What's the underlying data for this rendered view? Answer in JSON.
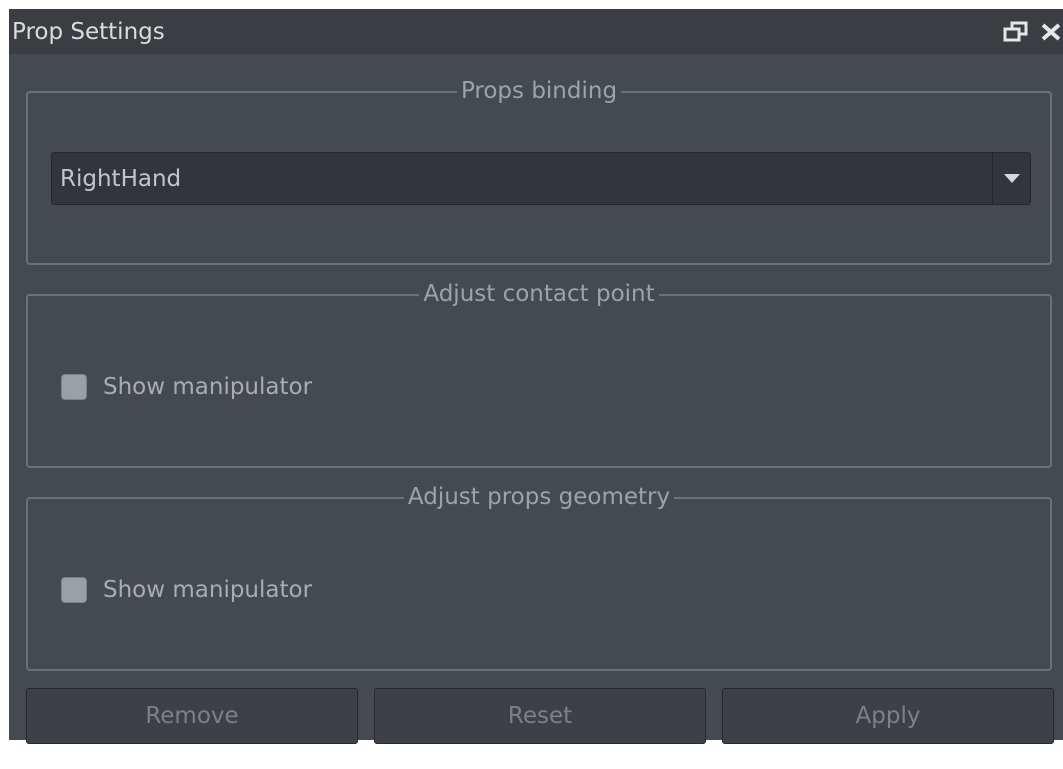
{
  "window": {
    "title": "Prop Settings"
  },
  "props_binding": {
    "legend": "Props binding",
    "selected": "RightHand"
  },
  "contact_point": {
    "legend": "Adjust contact point",
    "checkbox_label": "Show manipulator",
    "checked": false
  },
  "props_geometry": {
    "legend": "Adjust props geometry",
    "checkbox_label": "Show manipulator",
    "checked": false
  },
  "buttons": {
    "remove": "Remove",
    "reset": "Reset",
    "apply": "Apply"
  },
  "icons": {
    "float": "float-window-icon",
    "close": "close-icon"
  },
  "colors": {
    "panel": "#454a51",
    "titlebar": "#3a3e43",
    "text": "#dcdcdc"
  }
}
